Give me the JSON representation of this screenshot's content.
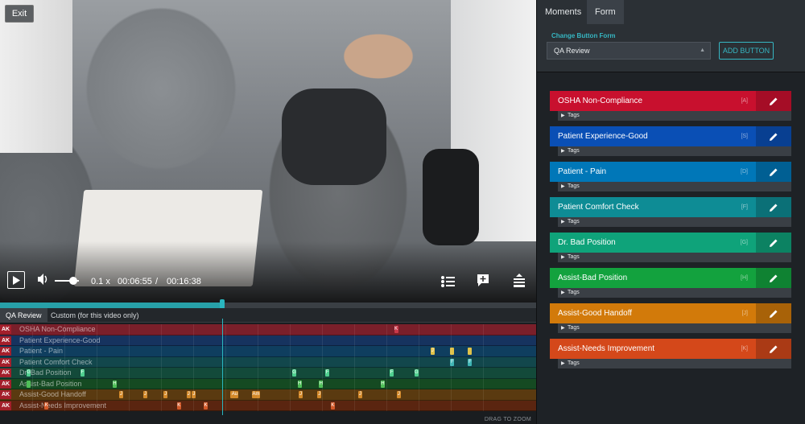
{
  "video": {
    "exit_label": "Exit",
    "speed": "0.1 x",
    "time_current": "00:06:55",
    "time_separator": "/",
    "time_total": "00:16:38",
    "progress_fraction": 0.415
  },
  "timeline": {
    "tabs": [
      {
        "label": "QA Review",
        "active": true
      },
      {
        "label": "Custom (for this video only)",
        "active": false
      }
    ],
    "badge": "AK",
    "drag_to_zoom": "DRAG TO ZOOM",
    "rows": [
      {
        "label": "OSHA Non-Compliance",
        "color": "#7a1f2a",
        "mark_color": "#c9394a",
        "marks": [
          {
            "x": 0.735,
            "text": "K"
          }
        ]
      },
      {
        "label": "Patient Experience-Good",
        "color": "#16335f",
        "mark_color": "#2b5fb8",
        "marks": []
      },
      {
        "label": "Patient - Pain",
        "color": "#0f3e5f",
        "mark_color": "#e0c24a",
        "marks": [
          {
            "x": 0.803,
            "text": "J"
          },
          {
            "x": 0.84,
            "text": ""
          },
          {
            "x": 0.873,
            "text": ""
          }
        ]
      },
      {
        "label": "Patient Comfort Check",
        "color": "#12474c",
        "mark_color": "#3fb5b5",
        "marks": [
          {
            "x": 0.84,
            "text": "F"
          },
          {
            "x": 0.873,
            "text": "F"
          }
        ]
      },
      {
        "label": "Dr. Bad Position",
        "color": "#134a3a",
        "mark_color": "#4fcf8f",
        "marks": [
          {
            "x": 0.05,
            "text": "G"
          },
          {
            "x": 0.15,
            "text": "F"
          },
          {
            "x": 0.545,
            "text": "G"
          },
          {
            "x": 0.607,
            "text": "F"
          },
          {
            "x": 0.727,
            "text": "F"
          },
          {
            "x": 0.773,
            "text": "G"
          }
        ]
      },
      {
        "label": "Assist-Bad Position",
        "color": "#154a22",
        "mark_color": "#4fbf58",
        "marks": [
          {
            "x": 0.05,
            "text": ""
          },
          {
            "x": 0.21,
            "text": "H"
          },
          {
            "x": 0.555,
            "text": "H"
          },
          {
            "x": 0.595,
            "text": "H"
          },
          {
            "x": 0.71,
            "text": "H"
          }
        ]
      },
      {
        "label": "Assist-Good Handoff",
        "color": "#5a3a10",
        "mark_color": "#d3892a",
        "marks": [
          {
            "x": 0.222,
            "text": "J"
          },
          {
            "x": 0.267,
            "text": "J"
          },
          {
            "x": 0.305,
            "text": "J"
          },
          {
            "x": 0.348,
            "text": "J"
          },
          {
            "x": 0.358,
            "text": "J"
          },
          {
            "x": 0.43,
            "text": "Au",
            "wide": true
          },
          {
            "x": 0.47,
            "text": "Am",
            "wide": true
          },
          {
            "x": 0.557,
            "text": "J"
          },
          {
            "x": 0.592,
            "text": "J"
          },
          {
            "x": 0.668,
            "text": "J"
          },
          {
            "x": 0.74,
            "text": "J"
          }
        ]
      },
      {
        "label": "Assist-Needs Improvement",
        "color": "#5a2510",
        "mark_color": "#d35a2a",
        "marks": [
          {
            "x": 0.083,
            "text": "K"
          },
          {
            "x": 0.33,
            "text": "K"
          },
          {
            "x": 0.38,
            "text": "K"
          },
          {
            "x": 0.617,
            "text": "K"
          }
        ]
      }
    ]
  },
  "panel": {
    "tabs": [
      {
        "label": "Moments",
        "active": false
      },
      {
        "label": "Form",
        "active": true
      }
    ],
    "form_label": "Change Button Form",
    "form_value": "QA Review",
    "add_button": "ADD BUTTON",
    "tags_label": "Tags",
    "buttons": [
      {
        "label": "OSHA Non-Compliance",
        "key": "[A]",
        "color": "#c8102e",
        "edit_color": "#a50d26"
      },
      {
        "label": "Patient Experience-Good",
        "key": "[S]",
        "color": "#0a4fb5",
        "edit_color": "#083f91"
      },
      {
        "label": "Patient - Pain",
        "key": "[D]",
        "color": "#0077b8",
        "edit_color": "#005f93"
      },
      {
        "label": "Patient Comfort Check",
        "key": "[F]",
        "color": "#0e8c95",
        "edit_color": "#0b7077"
      },
      {
        "label": "Dr. Bad Position",
        "key": "[G]",
        "color": "#0fa37a",
        "edit_color": "#0c8262"
      },
      {
        "label": "Assist-Bad Position",
        "key": "[H]",
        "color": "#13a23e",
        "edit_color": "#0f8232"
      },
      {
        "label": "Assist-Good Handoff",
        "key": "[J]",
        "color": "#d27a0a",
        "edit_color": "#a86208"
      },
      {
        "label": "Assist-Needs Improvement",
        "key": "[K]",
        "color": "#d4481a",
        "edit_color": "#aa3a15"
      }
    ]
  }
}
